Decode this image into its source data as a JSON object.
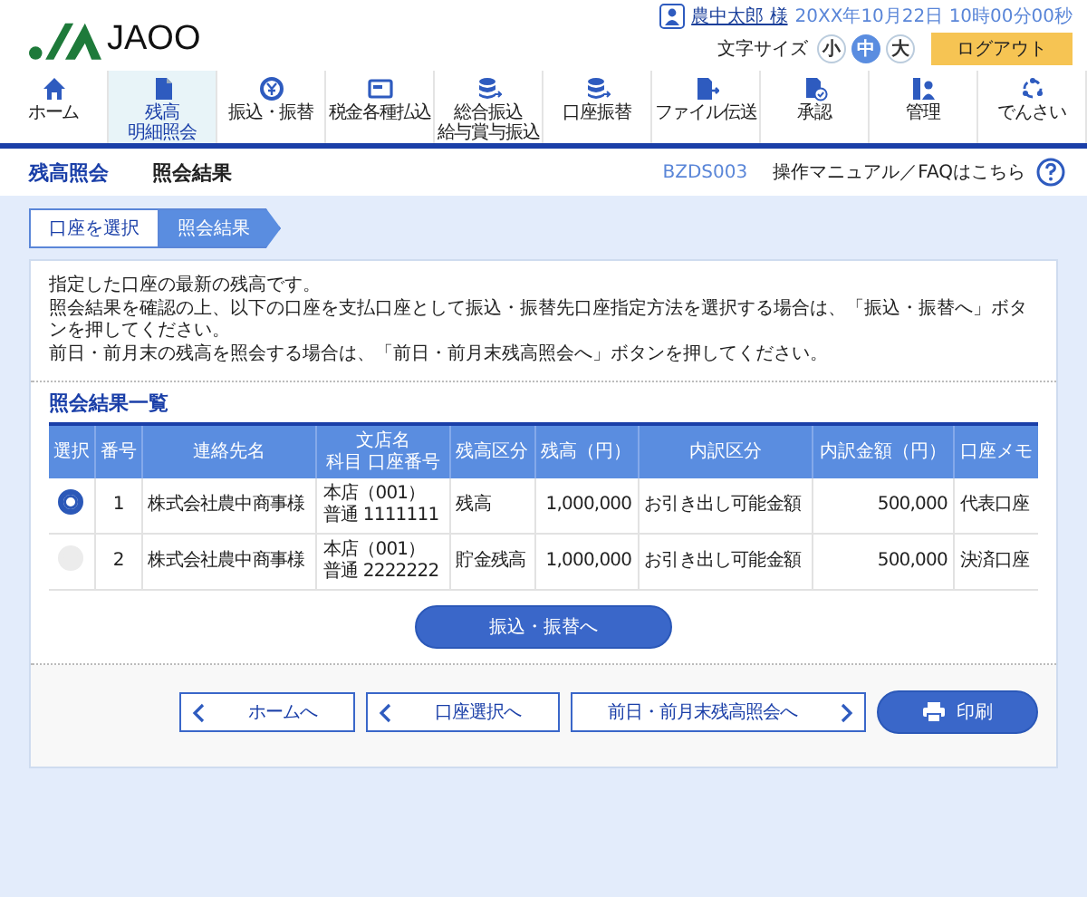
{
  "header": {
    "logo": "JAOO",
    "user_name": "農中太郎 様",
    "datetime": "20XX年10月22日 10時00分00秒",
    "font_size_label": "文字サイズ",
    "font_sizes": [
      {
        "label": "小",
        "selected": false
      },
      {
        "label": "中",
        "selected": true
      },
      {
        "label": "大",
        "selected": false
      }
    ],
    "logout": "ログアウト"
  },
  "nav": [
    {
      "kind": "home",
      "lines": [
        "ホーム"
      ],
      "selected": false
    },
    {
      "kind": "document",
      "lines": [
        "残高",
        "明細照会"
      ],
      "selected": true
    },
    {
      "kind": "yen",
      "lines": [
        "振込・振替"
      ],
      "selected": false
    },
    {
      "kind": "card",
      "lines": [
        "税金各種払込"
      ],
      "selected": false
    },
    {
      "kind": "database",
      "lines": [
        "総合振込",
        "給与賞与振込"
      ],
      "selected": false
    },
    {
      "kind": "database",
      "lines": [
        "口座振替"
      ],
      "selected": false
    },
    {
      "kind": "file",
      "lines": [
        "ファイル伝送"
      ],
      "selected": false
    },
    {
      "kind": "approve",
      "lines": [
        "承認"
      ],
      "selected": false
    },
    {
      "kind": "admin",
      "lines": [
        "管理"
      ],
      "selected": false
    },
    {
      "kind": "network",
      "lines": [
        "でんさい"
      ],
      "selected": false
    }
  ],
  "page": {
    "title": "残高照会",
    "subtitle": "照会結果",
    "screen_id": "BZDS003",
    "help": "操作マニュアル／FAQはこちら"
  },
  "steps": [
    {
      "label": "口座を選択",
      "selected": false
    },
    {
      "label": "照会結果",
      "selected": true
    }
  ],
  "intro": [
    "指定した口座の最新の残高です。",
    "照会結果を確認の上、以下の口座を支払口座として振込・振替先口座指定方法を選択する場合は、「振込・振替へ」ボタンを押してください。",
    "前日・前月末の残高を照会する場合は、「前日・前月末残高照会へ」ボタンを押してください。"
  ],
  "section_title": "照会結果一覧",
  "table": {
    "columns": [
      [
        "選択"
      ],
      [
        "番号"
      ],
      [
        "連絡先名"
      ],
      [
        "文店名",
        "科目 口座番号"
      ],
      [
        "残高区分"
      ],
      [
        "残高（円）"
      ],
      [
        "内訳区分"
      ],
      [
        "内訳金額（円）"
      ],
      [
        "口座メモ"
      ]
    ],
    "rows": [
      {
        "selected": true,
        "number": "1",
        "contact": "株式会社農中商事様",
        "branch": [
          "本店（001）",
          "普通 1111111"
        ],
        "balance_type": "残高",
        "balance": "1,000,000",
        "breakdown_type": "お引き出し可能金額",
        "breakdown_amount": "500,000",
        "memo": "代表口座"
      },
      {
        "selected": false,
        "number": "2",
        "contact": "株式会社農中商事様",
        "branch": [
          "本店（001）",
          "普通 2222222"
        ],
        "balance_type": "貯金残高",
        "balance": "1,000,000",
        "breakdown_type": "お引き出し可能金額",
        "breakdown_amount": "500,000",
        "memo": "決済口座"
      }
    ]
  },
  "transfer_button": "振込・振替へ",
  "footer_buttons": [
    {
      "kind": "back",
      "label": "ホームへ"
    },
    {
      "kind": "back",
      "label": "口座選択へ"
    },
    {
      "kind": "forward",
      "label": "前日・前月末残高照会へ"
    },
    {
      "kind": "print",
      "label": "印刷"
    }
  ]
}
